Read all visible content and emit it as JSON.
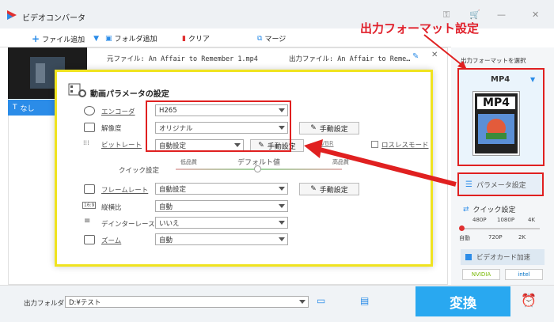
{
  "app": {
    "title": "ビデオコンバータ"
  },
  "toolbar": {
    "add_file": "ファイル追加",
    "add_folder": "フォルダ追加",
    "clear": "クリア",
    "merge": "マージ"
  },
  "file": {
    "source": "元ファイル: An Affair to Remember 1.mp4",
    "output": "出力ファイル: An Affair to Reme…",
    "subtitle": "なし"
  },
  "annotation": {
    "output_format_setting": "出力フォーマット設定"
  },
  "side": {
    "select_format": "出力フォーマットを選択",
    "format": "MP4",
    "format_icon": "MP4",
    "param_button": "パラメータ設定",
    "quick_title": "クイック設定",
    "q_top": [
      "480P",
      "1080P",
      "4K"
    ],
    "q_bottom": [
      "自動",
      "720P",
      "2K"
    ],
    "gpu": "ビデオカード加速",
    "nvidia": "NVIDIA",
    "intel": "intel"
  },
  "dialog": {
    "title": "動画パラメータの設定",
    "encoder_label": "エンコーダ",
    "encoder_value": "H265",
    "resolution_label": "解像度",
    "resolution_value": "オリジナル",
    "bitrate_label": "ビットレート",
    "bitrate_value": "自動設定",
    "vbr": "VBR",
    "lossless": "ロスレスモード",
    "quick_label": "クイック設定",
    "low_quality": "低品質",
    "default_value": "デフォルト値",
    "high_quality": "高品質",
    "framerate_label": "フレームレート",
    "framerate_value": "自動設定",
    "aspect_label": "縦横比",
    "aspect_value": "自動",
    "deinterlace_label": "デインターレース",
    "deinterlace_value": "いいえ",
    "zoom_label": "ズーム",
    "zoom_value": "自動",
    "manual": "手動設定"
  },
  "footer": {
    "output_folder_label": "出力フォルダ：",
    "output_folder_value": "D:¥テスト",
    "convert": "変換"
  }
}
